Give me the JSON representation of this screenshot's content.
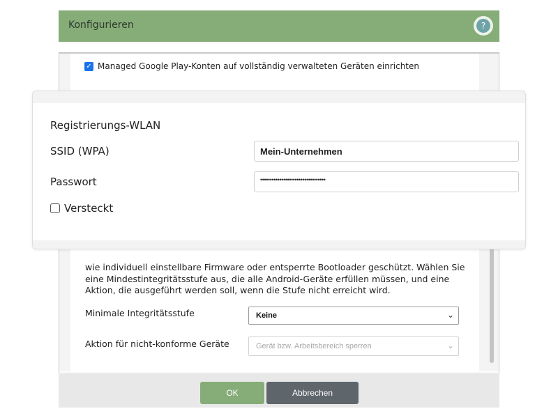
{
  "dialog": {
    "title": "Konfigurieren",
    "help_icon": "?",
    "managed_accounts_label": "Managed Google Play-Konten auf vollständig verwalteten Geräten einrichten",
    "managed_accounts_checked": true,
    "integrity_description": "wie individuell einstellbare Firmware oder entsperrte Bootloader geschützt. Wählen Sie eine Mindestintegritätsstufe aus, die alle Android-Geräte erfüllen müssen, und eine Aktion, die ausgeführt werden soll, wenn die Stufe nicht erreicht wird.",
    "min_integrity_label": "Minimale Integritätsstufe",
    "min_integrity_value": "Keine",
    "noncompliant_action_label": "Aktion für nicht-konforme Geräte",
    "noncompliant_action_placeholder": "Gerät bzw. Arbeitsbereich sperren",
    "ok_label": "OK",
    "cancel_label": "Abbrechen"
  },
  "popup": {
    "title": "Registrierungs-WLAN",
    "ssid_label": "SSID (WPA)",
    "ssid_value": "Mein-Unternehmen",
    "password_label": "Passwort",
    "password_value": "••••••••••••••••••••••••••••••••••",
    "hidden_label": "Versteckt",
    "hidden_checked": false
  },
  "colors": {
    "header_green": "#86ad78",
    "ok_button": "#86ad78",
    "cancel_button": "#5e666c",
    "checkbox_blue": "#1a73e8",
    "help_icon": "#6ea3a8"
  }
}
